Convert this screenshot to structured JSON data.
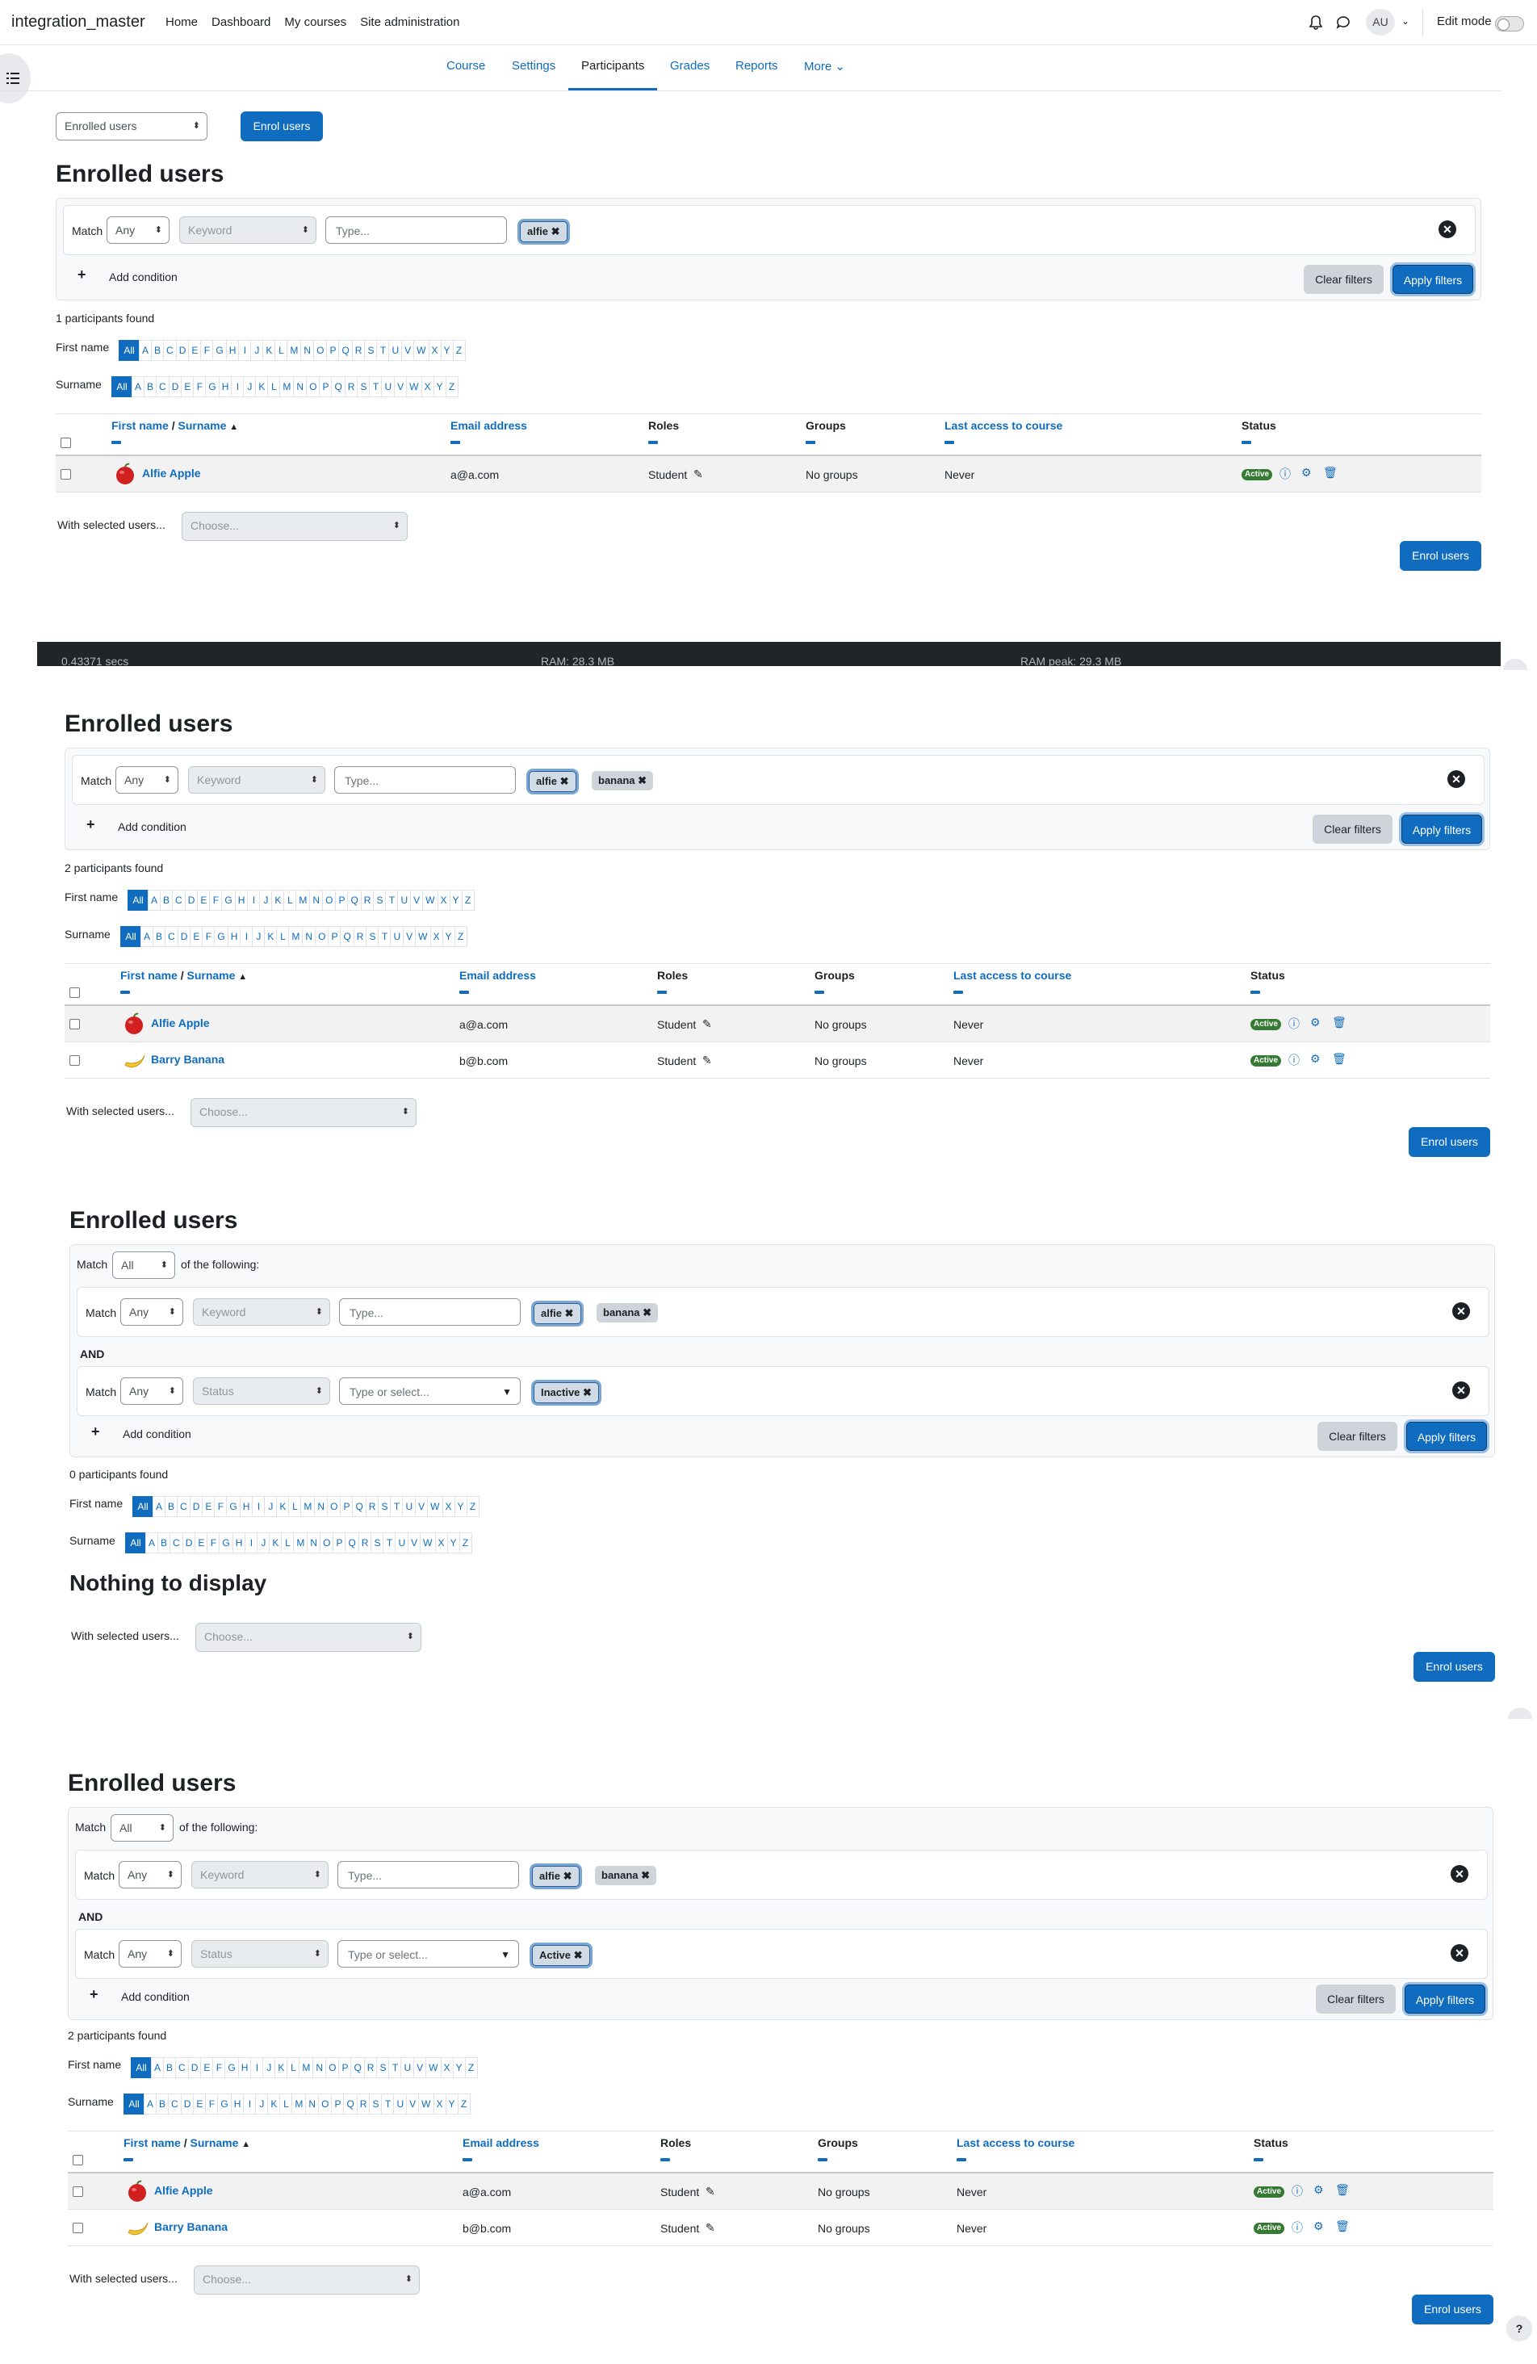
{
  "site": {
    "name": "integration_master",
    "nav": [
      "Home",
      "Dashboard",
      "My courses",
      "Site administration"
    ],
    "avatar": "AU",
    "edit_mode": "Edit mode"
  },
  "secnav": {
    "items": [
      "Course",
      "Settings",
      "Participants",
      "Grades",
      "Reports",
      "More"
    ],
    "active": "Participants"
  },
  "enrol_select": "Enrolled users",
  "enrol_button": "Enrol users",
  "heading": "Enrolled users",
  "labels": {
    "match": "Match",
    "of_following": "of the following:",
    "and": "AND",
    "add_condition": "Add condition",
    "clear_filters": "Clear filters",
    "apply_filters": "Apply filters",
    "first_name": "First name",
    "surname": "Surname",
    "with_selected": "With selected users...",
    "choose": "Choose...",
    "nothing": "Nothing to display",
    "type_placeholder": "Type...",
    "type_or_select": "Type or select...",
    "any": "Any",
    "all": "All",
    "keyword": "Keyword",
    "status": "Status"
  },
  "letters": [
    "All",
    "A",
    "B",
    "C",
    "D",
    "E",
    "F",
    "G",
    "H",
    "I",
    "J",
    "K",
    "L",
    "M",
    "N",
    "O",
    "P",
    "Q",
    "R",
    "S",
    "T",
    "U",
    "V",
    "W",
    "X",
    "Y",
    "Z"
  ],
  "table": {
    "col_first": "First name",
    "col_sep": " / ",
    "col_surname": "Surname",
    "col_email": "Email address",
    "col_roles": "Roles",
    "col_groups": "Groups",
    "col_access": "Last access to course",
    "col_status": "Status"
  },
  "users": [
    {
      "name": "Alfie Apple",
      "email": "a@a.com",
      "role": "Student",
      "groups": "No groups",
      "access": "Never",
      "status": "Active",
      "avatar": "apple"
    },
    {
      "name": "Barry Banana",
      "email": "b@b.com",
      "role": "Student",
      "groups": "No groups",
      "access": "Never",
      "status": "Active",
      "avatar": "banana"
    }
  ],
  "counts": [
    "1 participants found",
    "2 participants found",
    "0 participants found",
    "2 participants found"
  ],
  "tags": {
    "alfie": "alfie",
    "banana": "banana",
    "inactive": "Inactive",
    "active": "Active"
  },
  "footer": {
    "time": "0.43371 secs",
    "ram": "RAM: 28.3 MB",
    "ram_peak": "RAM peak: 29.3 MB"
  }
}
